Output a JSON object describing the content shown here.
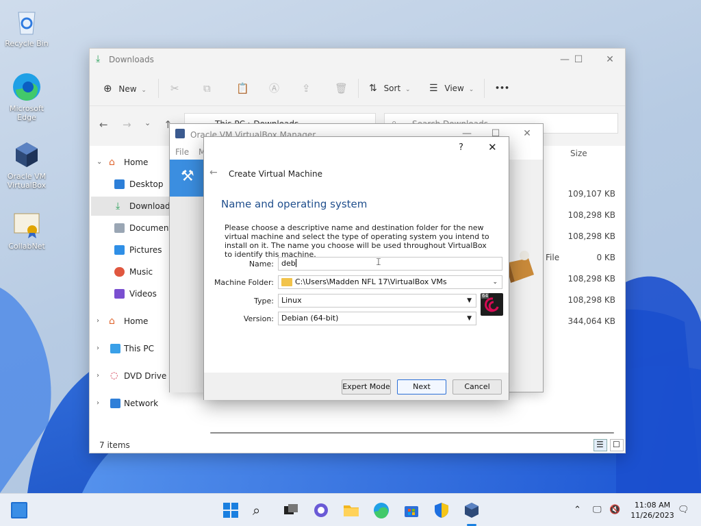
{
  "desktop": {
    "icons": [
      {
        "label": "Recycle Bin"
      },
      {
        "label": "Microsoft Edge"
      },
      {
        "label": "Oracle VM VirtualBox"
      },
      {
        "label": "CollabNet"
      }
    ]
  },
  "explorer": {
    "title": "Downloads",
    "toolbar": {
      "new_label": "New",
      "sort_label": "Sort",
      "view_label": "View",
      "more_label": "•••"
    },
    "address": "This PC  ›  Downloads",
    "search_placeholder": "Search Downloads",
    "sidebar": [
      {
        "label": "Home"
      },
      {
        "label": "Desktop"
      },
      {
        "label": "Downloads"
      },
      {
        "label": "Documents"
      },
      {
        "label": "Pictures"
      },
      {
        "label": "Music"
      },
      {
        "label": "Videos"
      },
      {
        "label": "Home"
      },
      {
        "label": "This PC"
      },
      {
        "label": "DVD Drive (E"
      },
      {
        "label": "Network"
      }
    ],
    "size_header": "Size",
    "type_fragment": "File",
    "sizes": [
      "109,107 KB",
      "108,298 KB",
      "108,298 KB",
      "0 KB",
      "108,298 KB",
      "108,298 KB",
      "344,064 KB"
    ],
    "status": "7 items"
  },
  "vbox_manager": {
    "title": "Oracle VM VirtualBox Manager",
    "menu_file": "File",
    "menu_machine": "M"
  },
  "dialog": {
    "help": "?",
    "heading": "Create Virtual Machine",
    "section": "Name and operating system",
    "description": "Please choose a descriptive name and destination folder for the new virtual machine and select the type of operating system you intend to install on it. The name you choose will be used throughout VirtualBox to identify this machine.",
    "name_label": "Name:",
    "name_value": "deb",
    "folder_label": "Machine Folder:",
    "folder_value": "C:\\Users\\Madden NFL 17\\VirtualBox VMs",
    "type_label": "Type:",
    "type_value": "Linux",
    "version_label": "Version:",
    "version_value": "Debian (64-bit)",
    "os_badge": "64",
    "expert_label": "Expert Mode",
    "next_label": "Next",
    "cancel_label": "Cancel"
  },
  "taskbar": {
    "time": "11:08 AM",
    "date": "11/26/2023"
  }
}
